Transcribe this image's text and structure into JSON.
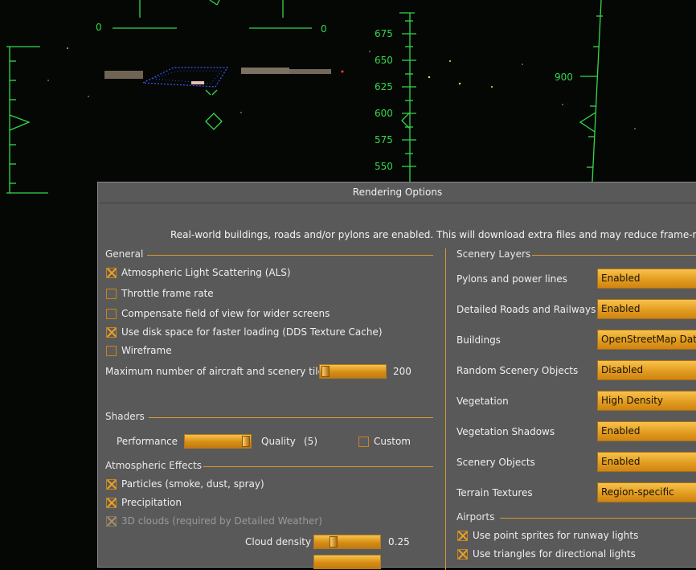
{
  "hud": {
    "pitch_left_label": "0",
    "pitch_right_label": "0",
    "altitude_ticks": [
      "675",
      "650",
      "625",
      "600",
      "575",
      "550"
    ],
    "heading_label": "900"
  },
  "dialog": {
    "title": "Rendering Options",
    "notice": "Real-world buildings, roads and/or pylons are enabled. This will download extra files and may reduce frame-rates.",
    "general": {
      "title": "General",
      "options": [
        {
          "label": "Atmospheric Light Scattering (ALS)",
          "checked": true
        },
        {
          "label": "Throttle frame rate",
          "checked": false
        },
        {
          "label": "Compensate field of view for wider screens",
          "checked": false
        },
        {
          "label": "Use disk space for faster loading (DDS Texture Cache)",
          "checked": true
        },
        {
          "label": "Wireframe",
          "checked": false
        }
      ],
      "max_tiles_label": "Maximum number of aircraft and scenery tiles",
      "max_tiles_value": "200",
      "max_tiles_fraction": 0.02
    },
    "shaders": {
      "title": "Shaders",
      "performance_label": "Performance",
      "quality_label": "Quality",
      "quality_value": "(5)",
      "quality_fraction": 1.0,
      "custom_label": "Custom",
      "custom_checked": false
    },
    "atmospheric": {
      "title": "Atmospheric Effects",
      "options": [
        {
          "label": "Particles (smoke, dust, spray)",
          "checked": true,
          "enabled": true
        },
        {
          "label": "Precipitation",
          "checked": true,
          "enabled": true
        },
        {
          "label": "3D clouds (required by Detailed Weather)",
          "checked": true,
          "enabled": false
        }
      ],
      "cloud_density_label": "Cloud density",
      "cloud_density_value": "0.25",
      "cloud_density_fraction": 0.25
    },
    "scenery": {
      "title": "Scenery Layers",
      "rows": [
        {
          "label": "Pylons and power lines",
          "value": "Enabled"
        },
        {
          "label": "Detailed Roads and Railways",
          "value": "Enabled"
        },
        {
          "label": "Buildings",
          "value": "OpenStreetMap Data"
        },
        {
          "label": "Random Scenery Objects",
          "value": "Disabled"
        },
        {
          "label": "Vegetation",
          "value": "High Density"
        },
        {
          "label": "Vegetation Shadows",
          "value": "Enabled"
        },
        {
          "label": "Scenery Objects",
          "value": "Enabled"
        },
        {
          "label": "Terrain Textures",
          "value": "Region-specific"
        }
      ]
    },
    "airports": {
      "title": "Airports",
      "options": [
        {
          "label": "Use point sprites for runway lights",
          "checked": true
        },
        {
          "label": "Use triangles for directional lights",
          "checked": true
        }
      ]
    }
  },
  "colors": {
    "hud_green": "#35d84a",
    "dialog_bg": "#595959",
    "accent_orange": "#d79a2b"
  }
}
